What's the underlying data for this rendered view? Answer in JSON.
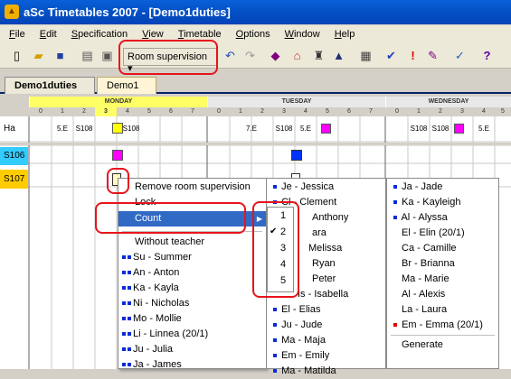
{
  "title": "aSc Timetables 2007  - [Demo1duties]",
  "menu": [
    "File",
    "Edit",
    "Specification",
    "View",
    "Timetable",
    "Options",
    "Window",
    "Help"
  ],
  "toolbar": {
    "room_supervision": "Room supervision"
  },
  "tabs": [
    "Demo1duties",
    "Demo1"
  ],
  "days": [
    "MONDAY",
    "TUESDAY",
    "WEDNESDAY"
  ],
  "periods": [
    "0",
    "1",
    "2",
    "3",
    "4",
    "5",
    "6",
    "7"
  ],
  "rows": {
    "r0": "Ha",
    "r1": "S106",
    "r2": "S107"
  },
  "cells": {
    "c1": "5.E",
    "c2": "S108",
    "c3": "S108",
    "c4": "7.E",
    "c5": "S108",
    "c6": "5.E",
    "c7": "S108",
    "c8": "S108",
    "c9": "5.E"
  },
  "context_menu": {
    "remove": "Remove room supervision",
    "lock": "Lock",
    "count": "Count",
    "without_teacher": "Without teacher",
    "items": [
      "Su - Summer",
      "An - Anton",
      "Ka - Kayla",
      "Ni - Nicholas",
      "Mo - Mollie",
      "Li - Linnea (20/1)",
      "Ju - Julia",
      "Ja - James"
    ]
  },
  "count_submenu": [
    "1",
    "2",
    "3",
    "4",
    "5"
  ],
  "col2": [
    "Je - Jessica",
    "Cl - Clement",
    "Anthony",
    "ara",
    "Melissa",
    "Ryan",
    "Peter",
    "Is - Isabella",
    "El - Elias",
    "Ju - Jude",
    "Ma - Maja",
    "Em - Emily",
    "Ma - Matilda"
  ],
  "col3": [
    "Ja - Jade",
    "Ka - Kayleigh",
    "Al - Alyssa",
    "El - Elin (20/1)",
    "Ca - Camille",
    "Br - Brianna",
    "Ma - Marie",
    "Al - Alexis",
    "La - Laura",
    "Em - Emma (20/1)",
    "Generate"
  ]
}
